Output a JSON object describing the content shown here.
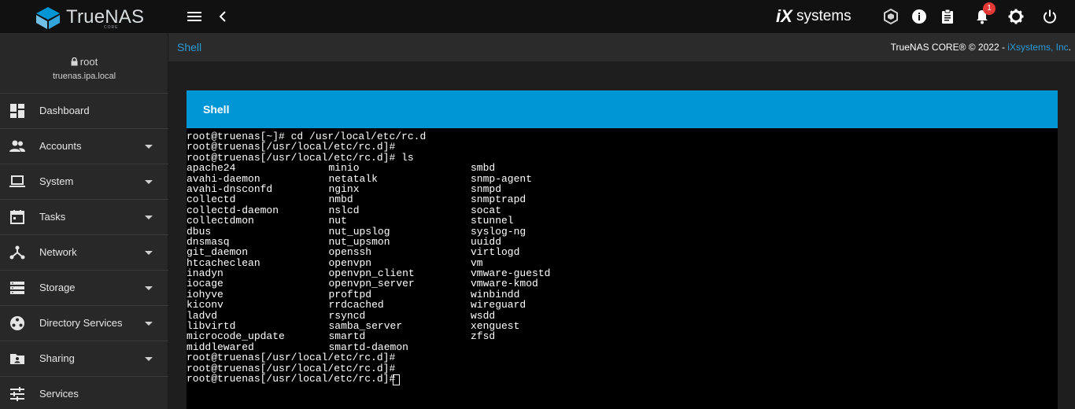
{
  "app": {
    "brand": "TrueNAS",
    "edition": "CORE",
    "vendor_logo": {
      "ix": "iX",
      "systems": "systems"
    },
    "notification_count": "1"
  },
  "topbar_icons": [
    "menu-icon",
    "back-chevron-icon",
    "truecommand-icon",
    "info-icon",
    "clipboard-icon",
    "bell-icon",
    "gear-icon",
    "power-icon"
  ],
  "user": {
    "name": "root",
    "host": "truenas.ipa.local"
  },
  "sidebar": {
    "items": [
      {
        "label": "Dashboard",
        "icon": "dashboard-icon",
        "expandable": false
      },
      {
        "label": "Accounts",
        "icon": "accounts-icon",
        "expandable": true
      },
      {
        "label": "System",
        "icon": "laptop-icon",
        "expandable": true
      },
      {
        "label": "Tasks",
        "icon": "calendar-icon",
        "expandable": true
      },
      {
        "label": "Network",
        "icon": "network-icon",
        "expandable": true
      },
      {
        "label": "Storage",
        "icon": "storage-icon",
        "expandable": true
      },
      {
        "label": "Directory Services",
        "icon": "directory-services-icon",
        "expandable": true
      },
      {
        "label": "Sharing",
        "icon": "sharing-folder-icon",
        "expandable": true
      },
      {
        "label": "Services",
        "icon": "services-sliders-icon",
        "expandable": false
      }
    ]
  },
  "breadcrumb": {
    "current": "Shell"
  },
  "copyright": {
    "text": "TrueNAS CORE® © 2022 - ",
    "link": "iXsystems, Inc",
    "end": "."
  },
  "card": {
    "title": "Shell"
  },
  "terminal": {
    "head": [
      "root@truenas[~]# cd /usr/local/etc/rc.d",
      "root@truenas[/usr/local/etc/rc.d]#",
      "root@truenas[/usr/local/etc/rc.d]# ls"
    ],
    "ls_columns": [
      [
        "apache24",
        "avahi-daemon",
        "avahi-dnsconfd",
        "collectd",
        "collectd-daemon",
        "collectdmon",
        "dbus",
        "dnsmasq",
        "git_daemon",
        "htcacheclean",
        "inadyn",
        "iocage",
        "iohyve",
        "kiconv",
        "ladvd",
        "libvirtd",
        "microcode_update",
        "middlewared"
      ],
      [
        "minio",
        "netatalk",
        "nginx",
        "nmbd",
        "nslcd",
        "nut",
        "nut_upslog",
        "nut_upsmon",
        "openssh",
        "openvpn",
        "openvpn_client",
        "openvpn_server",
        "proftpd",
        "rrdcached",
        "rsyncd",
        "samba_server",
        "smartd",
        "smartd-daemon"
      ],
      [
        "smbd",
        "snmp-agent",
        "snmpd",
        "snmptrapd",
        "socat",
        "stunnel",
        "syslog-ng",
        "uuidd",
        "virtlogd",
        "vm",
        "vmware-guestd",
        "vmware-kmod",
        "winbindd",
        "wireguard",
        "wsdd",
        "xenguest",
        "zfsd"
      ]
    ],
    "tail": [
      "root@truenas[/usr/local/etc/rc.d]#",
      "root@truenas[/usr/local/etc/rc.d]#",
      "root@truenas[/usr/local/etc/rc.d]# "
    ]
  },
  "colors": {
    "accent": "#0095d5",
    "link": "#2b9bd6",
    "topbar": "#111111",
    "sidebar": "#282828",
    "badge": "#e53935"
  }
}
